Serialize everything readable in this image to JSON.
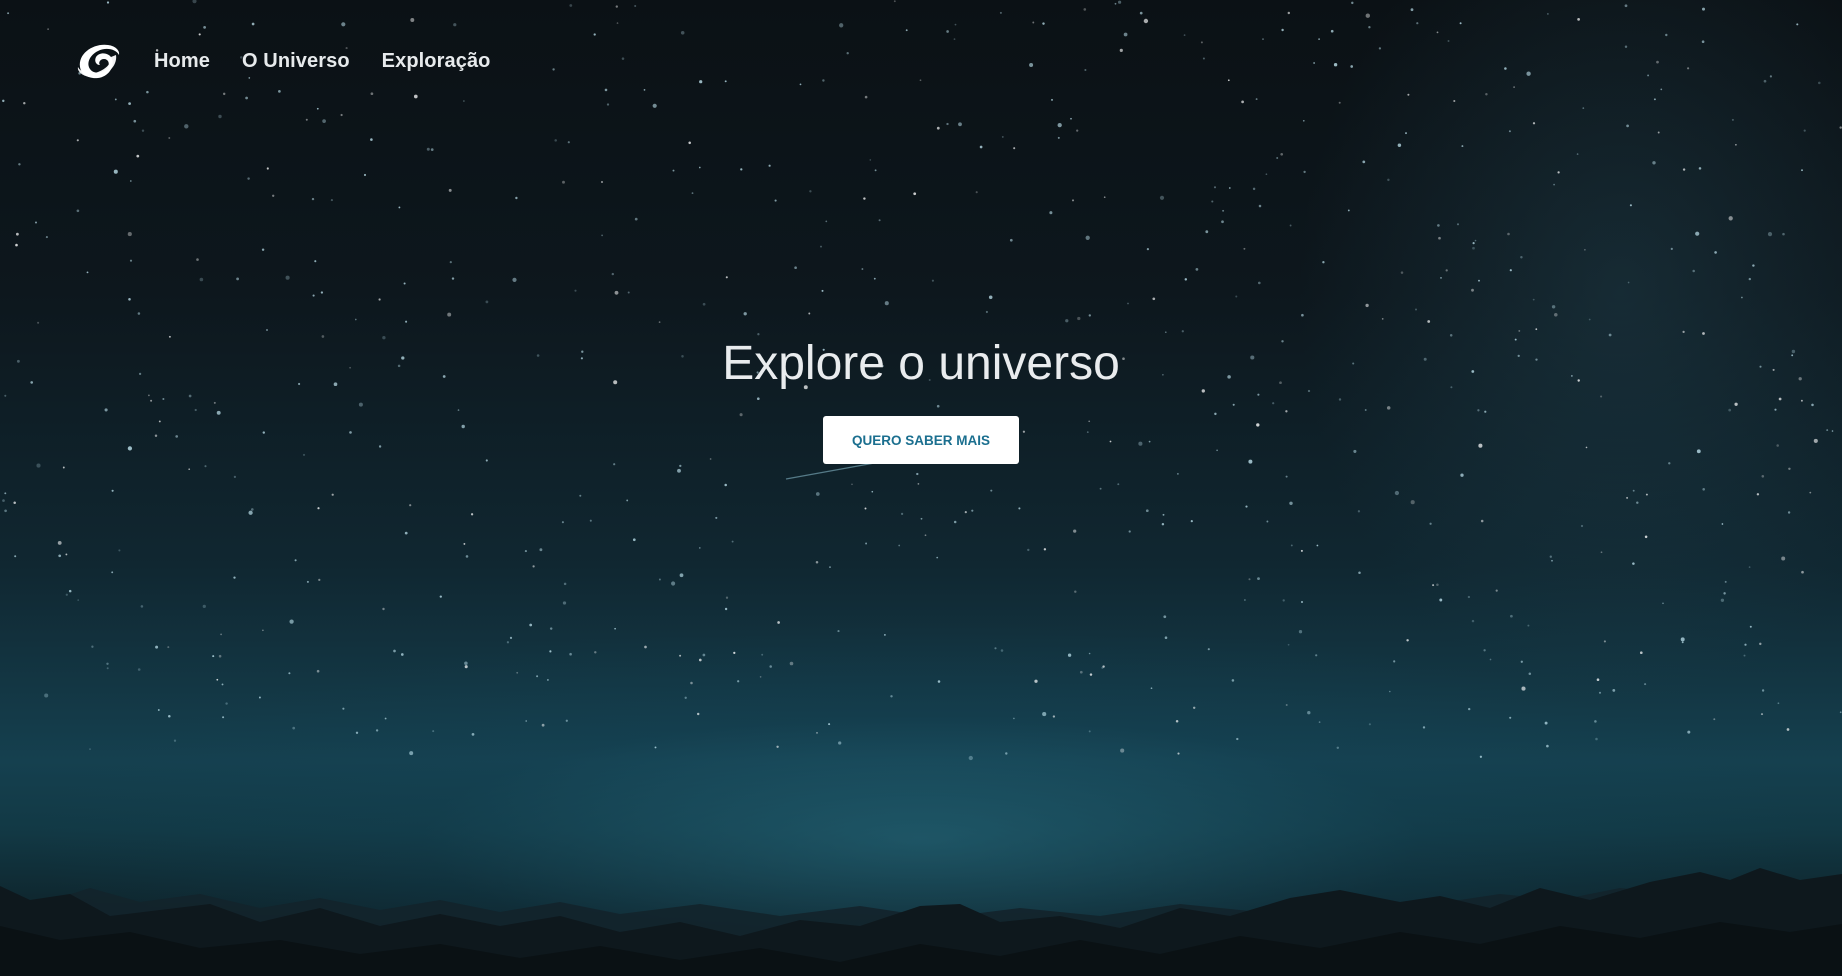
{
  "nav": {
    "logo_icon": "swirl-logo-icon",
    "links": [
      {
        "label": "Home"
      },
      {
        "label": "O Universo"
      },
      {
        "label": "Exploração"
      }
    ]
  },
  "hero": {
    "title": "Explore o universo",
    "cta_label": "QUERO SABER MAIS"
  },
  "colors": {
    "button_text": "#1b6f8f",
    "button_bg": "#ffffff",
    "nav_text": "#e7eaec",
    "sky_dark": "#0b1115",
    "horizon_glow": "#15404f"
  }
}
